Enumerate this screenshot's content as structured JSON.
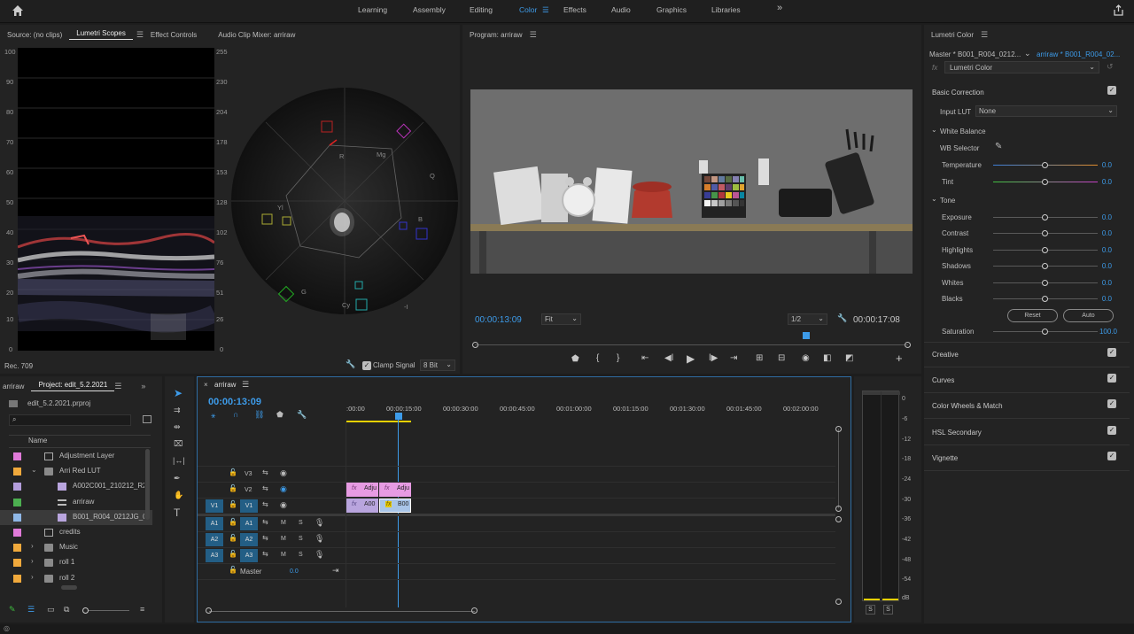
{
  "topbar": {
    "workspaces": [
      "Learning",
      "Assembly",
      "Editing",
      "Color",
      "Effects",
      "Audio",
      "Graphics",
      "Libraries"
    ],
    "active": "Color",
    "more": "»"
  },
  "source_panel": {
    "tabs": [
      "Source: (no clips)",
      "Lumetri Scopes",
      "Effect Controls",
      "Audio Clip Mixer: arriraw"
    ],
    "active_tab": "Lumetri Scopes",
    "waveform_left_ticks": [
      "100",
      "90",
      "80",
      "70",
      "60",
      "50",
      "40",
      "30",
      "20",
      "10",
      "0"
    ],
    "waveform_right_ticks": [
      "255",
      "230",
      "204",
      "178",
      "153",
      "128",
      "102",
      "76",
      "51",
      "26",
      "0"
    ],
    "vectorscope_labels": {
      "r": "R",
      "mg": "Mg",
      "q": "Q",
      "yl": "Yl",
      "b": "B",
      "g": "G",
      "cy": "Cy",
      "i": "-I"
    },
    "footer_left": "Rec. 709",
    "clamp_signal": "Clamp Signal",
    "bit_depth": "8 Bit"
  },
  "program": {
    "title": "Program: arriraw",
    "timecode": "00:00:13:09",
    "fit": "Fit",
    "resolution": "1/2",
    "duration": "00:00:17:08",
    "playhead_fraction": 0.765
  },
  "lumetri": {
    "title": "Lumetri Color",
    "master": "Master * B001_R004_0212...",
    "clip": "arriraw * B001_R004_02...",
    "fx": "Lumetri Color",
    "basic_correction": "Basic Correction",
    "input_lut_label": "Input LUT",
    "input_lut_value": "None",
    "white_balance": "White Balance",
    "wb_selector": "WB Selector",
    "temperature": {
      "label": "Temperature",
      "value": "0.0"
    },
    "tint": {
      "label": "Tint",
      "value": "0.0"
    },
    "tone": "Tone",
    "tone_rows": [
      {
        "label": "Exposure",
        "value": "0.0"
      },
      {
        "label": "Contrast",
        "value": "0.0"
      },
      {
        "label": "Highlights",
        "value": "0.0"
      },
      {
        "label": "Shadows",
        "value": "0.0"
      },
      {
        "label": "Whites",
        "value": "0.0"
      },
      {
        "label": "Blacks",
        "value": "0.0"
      }
    ],
    "reset": "Reset",
    "auto": "Auto",
    "saturation": {
      "label": "Saturation",
      "value": "100.0"
    },
    "sections": [
      "Creative",
      "Curves",
      "Color Wheels & Match",
      "HSL Secondary",
      "Vignette"
    ]
  },
  "project": {
    "tabs": [
      "arriraw",
      "Project: edit_5.2.2021"
    ],
    "active_tab": "Project: edit_5.2.2021",
    "file": "edit_5.2.2021.prproj",
    "search_placeholder": "",
    "column_name": "Name",
    "items": [
      {
        "name": "Adjustment Layer",
        "color": "#e07ad9",
        "indent": 0,
        "kind": "adjust",
        "selected": false,
        "twirl": ""
      },
      {
        "name": "Arri Red LUT",
        "color": "#f0a93c",
        "indent": 0,
        "kind": "folder",
        "selected": false,
        "twirl": "⌄"
      },
      {
        "name": "A002C001_210212_R2",
        "color": "#b39ddb",
        "indent": 1,
        "kind": "clip",
        "selected": false,
        "twirl": ""
      },
      {
        "name": "arriraw",
        "color": "#4caf50",
        "indent": 1,
        "kind": "sequence",
        "selected": false,
        "twirl": ""
      },
      {
        "name": "B001_R004_0212JG_0",
        "color": "#8fb7e6",
        "indent": 1,
        "kind": "clip",
        "selected": true,
        "twirl": ""
      },
      {
        "name": "credits",
        "color": "#e07ad9",
        "indent": 0,
        "kind": "adjust",
        "selected": false,
        "twirl": ""
      },
      {
        "name": "Music",
        "color": "#f0a93c",
        "indent": 0,
        "kind": "folder",
        "selected": false,
        "twirl": "›"
      },
      {
        "name": "roll 1",
        "color": "#f0a93c",
        "indent": 0,
        "kind": "folder",
        "selected": false,
        "twirl": "›"
      },
      {
        "name": "roll 2",
        "color": "#f0a93c",
        "indent": 0,
        "kind": "folder",
        "selected": false,
        "twirl": "›"
      }
    ]
  },
  "timeline": {
    "tab": "arriraw",
    "timecode": "00:00:13:09",
    "ruler": [
      ":00:00",
      "00:00:15:00",
      "00:00:30:00",
      "00:00:45:00",
      "00:01:00:00",
      "00:01:15:00",
      "00:01:30:00",
      "00:01:45:00",
      "00:02:00:00"
    ],
    "tracks": {
      "v3": "V3",
      "v2": "V2",
      "v1": "V1",
      "a1": "A1",
      "a2": "A2",
      "a3": "A3",
      "m": "M",
      "s": "S",
      "master": "Master",
      "master_value": "0.0"
    },
    "clips": {
      "v2a": "Adju",
      "v2b": "Adju",
      "v1a": "A00",
      "v1b": "B00",
      "fx": "fx"
    }
  },
  "meter": {
    "labels": [
      "0",
      "-6",
      "-12",
      "-18",
      "-24",
      "-30",
      "-36",
      "-42",
      "-48",
      "-54",
      "dB"
    ],
    "solo": [
      "S",
      "S"
    ]
  },
  "colors": {
    "accent": "#3d9be9",
    "track_blue": "#235e85",
    "adjustment_clip": "#e79be3",
    "video_clip": "#b9a5de"
  }
}
